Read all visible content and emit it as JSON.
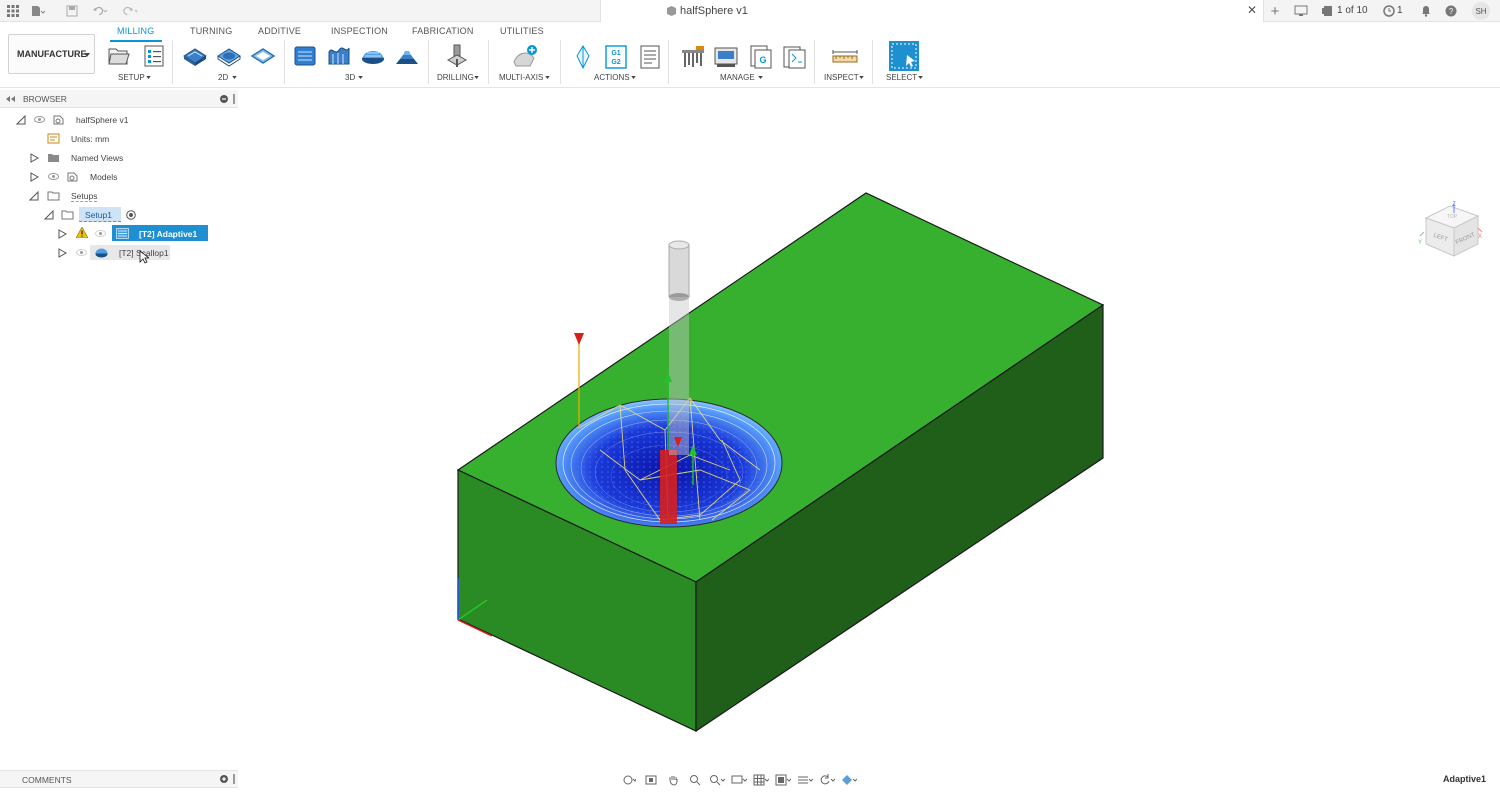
{
  "titlebar": {
    "doc_title": "halfSphere v1",
    "page_counter": "1 of 10",
    "notifications_count": "1",
    "user_initials": "SH"
  },
  "ribbon": {
    "workspace": "MANUFACTURE",
    "tabs": [
      "MILLING",
      "TURNING",
      "ADDITIVE",
      "INSPECTION",
      "FABRICATION",
      "UTILITIES"
    ],
    "active_tab": "MILLING",
    "groups": {
      "setup": "SETUP",
      "twod": "2D",
      "threed": "3D",
      "drilling": "DRILLING",
      "multiaxis": "MULTI-AXIS",
      "actions": "ACTIONS",
      "manage": "MANAGE",
      "inspect": "INSPECT",
      "select": "SELECT"
    },
    "nc_icon_text": [
      "G1",
      "G2"
    ]
  },
  "browser": {
    "header": "BROWSER",
    "items": [
      {
        "label": "halfSphere v1"
      },
      {
        "label": "Units: mm"
      },
      {
        "label": "Named Views"
      },
      {
        "label": "Models"
      },
      {
        "label": "Setups"
      },
      {
        "label": "Setup1"
      },
      {
        "label": "[T2] Adaptive1"
      },
      {
        "label": "[T2] Scallop1"
      }
    ]
  },
  "viewcube": {
    "top": "TOP",
    "left": "LEFT",
    "front": "FRONT",
    "axis_z": "Z",
    "axis_x": "X",
    "axis_y": "Y"
  },
  "comments": {
    "header": "COMMENTS"
  },
  "status": {
    "active_operation": "Adaptive1"
  },
  "colors": {
    "accent": "#0696d7",
    "stock_top": "#36b02e",
    "stock_front": "#2a8a24",
    "stock_side": "#1f5f1a",
    "selection": "#1e8fd0"
  }
}
